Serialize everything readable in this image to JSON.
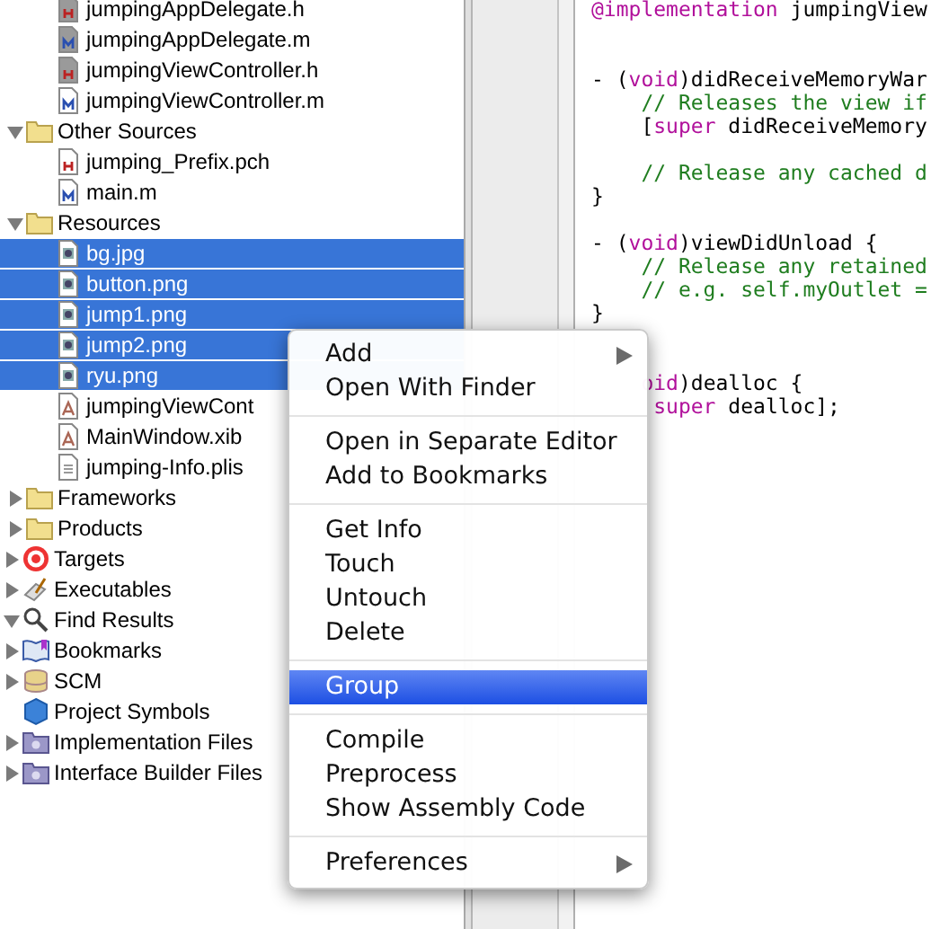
{
  "sidebar": {
    "tree": [
      {
        "children": [
          {
            "children": [
              {
                "label": "jumpingAppDelegate.h",
                "kind": "header",
                "shaded": true,
                "selected": false
              },
              {
                "label": "jumpingAppDelegate.m",
                "kind": "impl",
                "shaded": true,
                "selected": false
              },
              {
                "label": "jumpingViewController.h",
                "kind": "header",
                "shaded": true,
                "selected": false
              },
              {
                "label": "jumpingViewController.m",
                "kind": "impl",
                "shaded": false,
                "selected": false
              }
            ]
          },
          {
            "label": "Other Sources",
            "kind": "folder",
            "expanded": true,
            "selected": false,
            "children": [
              {
                "label": "jumping_Prefix.pch",
                "kind": "header",
                "shaded": false,
                "selected": false
              },
              {
                "label": "main.m",
                "kind": "impl",
                "shaded": false,
                "selected": false
              }
            ]
          },
          {
            "label": "Resources",
            "kind": "folder",
            "expanded": true,
            "selected": false,
            "children": [
              {
                "label": "bg.jpg",
                "kind": "image",
                "shaded": false,
                "selected": true
              },
              {
                "label": "button.png",
                "kind": "image",
                "shaded": false,
                "selected": true
              },
              {
                "label": "jump1.png",
                "kind": "image",
                "shaded": false,
                "selected": true
              },
              {
                "label": "jump2.png",
                "kind": "image",
                "shaded": false,
                "selected": true
              },
              {
                "label": "ryu.png",
                "kind": "image",
                "shaded": false,
                "selected": true
              },
              {
                "label": "jumpingViewCont",
                "kind": "xib",
                "shaded": false,
                "selected": false
              },
              {
                "label": "MainWindow.xib",
                "kind": "xib",
                "shaded": false,
                "selected": false
              },
              {
                "label": "jumping-Info.plis",
                "kind": "plist",
                "shaded": false,
                "selected": false
              }
            ]
          },
          {
            "label": "Frameworks",
            "kind": "folder",
            "expanded": false,
            "selected": false
          },
          {
            "label": "Products",
            "kind": "folder",
            "expanded": false,
            "selected": false
          }
        ]
      },
      {
        "label": "Targets",
        "kind": "target",
        "expanded": false,
        "selected": false
      },
      {
        "label": "Executables",
        "kind": "exec",
        "expanded": false,
        "selected": false
      },
      {
        "label": "Find Results",
        "kind": "find",
        "expanded": true,
        "selected": false
      },
      {
        "label": "Bookmarks",
        "kind": "bookmarks",
        "expanded": false,
        "selected": false
      },
      {
        "label": "SCM",
        "kind": "scm",
        "expanded": false,
        "selected": false
      },
      {
        "label": "Project Symbols",
        "kind": "symbols",
        "selected": false
      },
      {
        "label": "Implementation Files",
        "kind": "smart",
        "expanded": false,
        "selected": false
      },
      {
        "label": "Interface Builder Files",
        "kind": "smart",
        "expanded": false,
        "selected": false
      }
    ]
  },
  "editor": {
    "lines": [
      {
        "kind": "code",
        "segments": [
          {
            "kind": "keyword",
            "text": "@implementation"
          },
          {
            "kind": "plain",
            "text": " jumpingView"
          }
        ]
      },
      {
        "kind": "blank"
      },
      {
        "kind": "blank"
      },
      {
        "kind": "code",
        "segments": [
          {
            "kind": "plain",
            "text": "- ("
          },
          {
            "kind": "keyword",
            "text": "void"
          },
          {
            "kind": "plain",
            "text": ")didReceiveMemoryWar"
          }
        ]
      },
      {
        "kind": "code",
        "segments": [
          {
            "kind": "comment",
            "text": "    // Releases the view if"
          }
        ]
      },
      {
        "kind": "code",
        "segments": [
          {
            "kind": "plain",
            "text": "    ["
          },
          {
            "kind": "keyword",
            "text": "super"
          },
          {
            "kind": "plain",
            "text": " didReceiveMemory"
          }
        ]
      },
      {
        "kind": "blank"
      },
      {
        "kind": "code",
        "segments": [
          {
            "kind": "comment",
            "text": "    // Release any cached d"
          }
        ]
      },
      {
        "kind": "code",
        "segments": [
          {
            "kind": "plain",
            "text": "}"
          }
        ]
      },
      {
        "kind": "blank"
      },
      {
        "kind": "code",
        "segments": [
          {
            "kind": "plain",
            "text": "- ("
          },
          {
            "kind": "keyword",
            "text": "void"
          },
          {
            "kind": "plain",
            "text": ")viewDidUnload {"
          }
        ]
      },
      {
        "kind": "code",
        "segments": [
          {
            "kind": "comment",
            "text": "    // Release any retained"
          }
        ]
      },
      {
        "kind": "code",
        "segments": [
          {
            "kind": "comment",
            "text": "    // e.g. self.myOutlet ="
          }
        ]
      },
      {
        "kind": "code",
        "segments": [
          {
            "kind": "plain",
            "text": "}"
          }
        ]
      },
      {
        "kind": "blank"
      },
      {
        "kind": "blank"
      },
      {
        "kind": "code",
        "segments": [
          {
            "kind": "keyword",
            "text": "    oid"
          },
          {
            "kind": "plain",
            "text": ")dealloc {"
          }
        ]
      },
      {
        "kind": "code",
        "segments": [
          {
            "kind": "keyword",
            "text": "     super"
          },
          {
            "kind": "plain",
            "text": " dealloc];"
          }
        ]
      }
    ]
  },
  "context_menu": {
    "sections": [
      {
        "items": [
          {
            "label": "Add",
            "submenu": true,
            "selected": false
          },
          {
            "label": "Open With Finder",
            "submenu": false,
            "selected": false
          }
        ]
      },
      {
        "items": [
          {
            "label": "Open in Separate Editor",
            "submenu": false,
            "selected": false
          },
          {
            "label": "Add to Bookmarks",
            "submenu": false,
            "selected": false
          }
        ]
      },
      {
        "items": [
          {
            "label": "Get Info",
            "submenu": false,
            "selected": false
          },
          {
            "label": "Touch",
            "submenu": false,
            "selected": false
          },
          {
            "label": "Untouch",
            "submenu": false,
            "selected": false
          },
          {
            "label": "Delete",
            "submenu": false,
            "selected": false
          }
        ]
      },
      {
        "items": [
          {
            "label": "Group",
            "submenu": false,
            "selected": true
          }
        ]
      },
      {
        "items": [
          {
            "label": "Compile",
            "submenu": false,
            "selected": false
          },
          {
            "label": "Preprocess",
            "submenu": false,
            "selected": false
          },
          {
            "label": "Show Assembly Code",
            "submenu": false,
            "selected": false
          }
        ]
      },
      {
        "items": [
          {
            "label": "Preferences",
            "submenu": true,
            "selected": false
          }
        ]
      }
    ]
  }
}
